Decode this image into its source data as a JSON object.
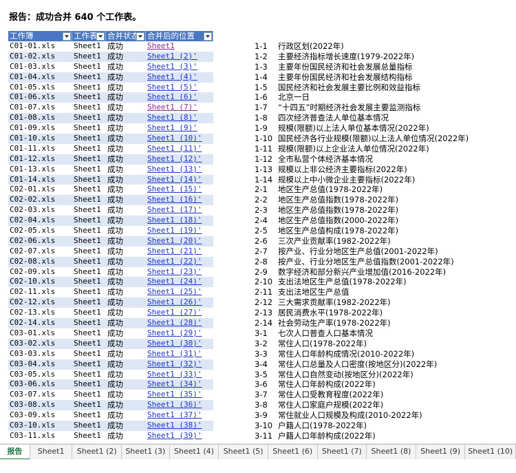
{
  "report_title": "报告：成功合并 640 个工作表。",
  "headers": [
    "工作簿",
    "工作表",
    "合并状态",
    "合并后的位置"
  ],
  "rows": [
    [
      "C01-01.xls",
      "Sheet1",
      "成功",
      "Sheet1"
    ],
    [
      "C01-02.xls",
      "Sheet1",
      "成功",
      "Sheet1 (2)'"
    ],
    [
      "C01-03.xls",
      "Sheet1",
      "成功",
      "Sheet1 (3)'"
    ],
    [
      "C01-04.xls",
      "Sheet1",
      "成功",
      "Sheet1 (4)'"
    ],
    [
      "C01-05.xls",
      "Sheet1",
      "成功",
      "Sheet1 (5)'"
    ],
    [
      "C01-06.xls",
      "Sheet1",
      "成功",
      "Sheet1 (6)'"
    ],
    [
      "C01-07.xls",
      "Sheet1",
      "成功",
      "Sheet1 (7)'"
    ],
    [
      "C01-08.xls",
      "Sheet1",
      "成功",
      "Sheet1 (8)'"
    ],
    [
      "C01-09.xls",
      "Sheet1",
      "成功",
      "Sheet1 (9)'"
    ],
    [
      "C01-10.xls",
      "Sheet1",
      "成功",
      "Sheet1 (10)'"
    ],
    [
      "C01-11.xls",
      "Sheet1",
      "成功",
      "Sheet1 (11)'"
    ],
    [
      "C01-12.xls",
      "Sheet1",
      "成功",
      "Sheet1 (12)'"
    ],
    [
      "C01-13.xls",
      "Sheet1",
      "成功",
      "Sheet1 (13)'"
    ],
    [
      "C01-14.xls",
      "Sheet1",
      "成功",
      "Sheet1 (14)'"
    ],
    [
      "C02-01.xls",
      "Sheet1",
      "成功",
      "Sheet1 (15)'"
    ],
    [
      "C02-02.xls",
      "Sheet1",
      "成功",
      "Sheet1 (16)'"
    ],
    [
      "C02-03.xls",
      "Sheet1",
      "成功",
      "Sheet1 (17)'"
    ],
    [
      "C02-04.xls",
      "Sheet1",
      "成功",
      "Sheet1 (18)'"
    ],
    [
      "C02-05.xls",
      "Sheet1",
      "成功",
      "Sheet1 (19)'"
    ],
    [
      "C02-06.xls",
      "Sheet1",
      "成功",
      "Sheet1 (20)'"
    ],
    [
      "C02-07.xls",
      "Sheet1",
      "成功",
      "Sheet1 (21)'"
    ],
    [
      "C02-08.xls",
      "Sheet1",
      "成功",
      "Sheet1 (22)'"
    ],
    [
      "C02-09.xls",
      "Sheet1",
      "成功",
      "Sheet1 (23)'"
    ],
    [
      "C02-10.xls",
      "Sheet1",
      "成功",
      "Sheet1 (24)'"
    ],
    [
      "C02-11.xls",
      "Sheet1",
      "成功",
      "Sheet1 (25)'"
    ],
    [
      "C02-12.xls",
      "Sheet1",
      "成功",
      "Sheet1 (26)'"
    ],
    [
      "C02-13.xls",
      "Sheet1",
      "成功",
      "Sheet1 (27)'"
    ],
    [
      "C02-14.xls",
      "Sheet1",
      "成功",
      "Sheet1 (28)'"
    ],
    [
      "C03-01.xls",
      "Sheet1",
      "成功",
      "Sheet1 (29)'"
    ],
    [
      "C03-02.xls",
      "Sheet1",
      "成功",
      "Sheet1 (30)'"
    ],
    [
      "C03-03.xls",
      "Sheet1",
      "成功",
      "Sheet1 (31)'"
    ],
    [
      "C03-04.xls",
      "Sheet1",
      "成功",
      "Sheet1 (32)'"
    ],
    [
      "C03-05.xls",
      "Sheet1",
      "成功",
      "Sheet1 (33)'"
    ],
    [
      "C03-06.xls",
      "Sheet1",
      "成功",
      "Sheet1 (34)'"
    ],
    [
      "C03-07.xls",
      "Sheet1",
      "成功",
      "Sheet1 (35)'"
    ],
    [
      "C03-08.xls",
      "Sheet1",
      "成功",
      "Sheet1 (36)'"
    ],
    [
      "C03-09.xls",
      "Sheet1",
      "成功",
      "Sheet1 (37)'"
    ],
    [
      "C03-10.xls",
      "Sheet1",
      "成功",
      "Sheet1 (38)'"
    ],
    [
      "C03-11.xls",
      "Sheet1",
      "成功",
      "Sheet1 (39)'"
    ]
  ],
  "visited_links": [
    0,
    6
  ],
  "index_list": [
    [
      "1-1",
      "行政区划(2022年)"
    ],
    [
      "1-2",
      "主要经济指标增长速度(1979-2022年)"
    ],
    [
      "1-3",
      "主要年份国民经济和社会发展总量指标"
    ],
    [
      "1-4",
      "主要年份国民经济和社会发展结构指标"
    ],
    [
      "1-5",
      "国民经济和社会发展主要比例和效益指标"
    ],
    [
      "1-6",
      "北京一日"
    ],
    [
      "1-7",
      "“十四五”时期经济社会发展主要监测指标"
    ],
    [
      "1-8",
      "四次经济普查法人单位基本情况"
    ],
    [
      "1-9",
      "规模(限额)以上法人单位基本情况(2022年)"
    ],
    [
      "1-10",
      "国民经济各行业规模(限额)以上法人单位情况(2022年)"
    ],
    [
      "1-11",
      "规模(限额)以上企业法人单位情况(2022年)"
    ],
    [
      "1-12",
      "全市私营个体经济基本情况"
    ],
    [
      "1-13",
      "规模以上非公经济主要指标(2022年)"
    ],
    [
      "1-14",
      "规模以上中小微企业主要指标(2022年)"
    ],
    [
      "2-1",
      "地区生产总值(1978-2022年)"
    ],
    [
      "2-2",
      "地区生产总值指数(1978-2022年)"
    ],
    [
      "2-3",
      "地区生产总值指数(1978-2022年)"
    ],
    [
      "2-4",
      "地区生产总值指数(2000-2022年)"
    ],
    [
      "2-5",
      "地区生产总值构成(1978-2022年)"
    ],
    [
      "2-6",
      "三次产业贡献率(1982-2022年)"
    ],
    [
      "2-7",
      "按产业、行业分地区生产总值(2001-2022年)"
    ],
    [
      "2-8",
      "按产业、行业分地区生产总值指数(2001-2022年)"
    ],
    [
      "2-9",
      "数字经济和部分新兴产业增加值(2016-2022年)"
    ],
    [
      "2-10",
      "支出法地区生产总值(1978-2022年)"
    ],
    [
      "2-11",
      "支出法地区生产总值"
    ],
    [
      "2-12",
      "三大需求贡献率(1982-2022年)"
    ],
    [
      "2-13",
      "居民消费水平(1978-2022年)"
    ],
    [
      "2-14",
      "社会劳动生产率(1978-2022年)"
    ],
    [
      "3-1",
      "七次人口普查人口基本情况"
    ],
    [
      "3-2",
      "常住人口(1978-2022年)"
    ],
    [
      "3-3",
      "常住人口年龄构成情况(2010-2022年)"
    ],
    [
      "3-4",
      "常住人口总量及人口密度(按地区分)(2022年)"
    ],
    [
      "3-5",
      "常住人口自然变动(按地区分)(2022年)"
    ],
    [
      "3-6",
      "常住人口年龄构成(2022年)"
    ],
    [
      "3-7",
      "常住人口受教育程度(2022年)"
    ],
    [
      "3-8",
      "常住人口家庭户规模(2022年)"
    ],
    [
      "3-9",
      "常住就业人口规模及构成(2010-2022年)"
    ],
    [
      "3-10",
      "户籍人口(1978-2022年)"
    ],
    [
      "3-11",
      "户籍人口年龄构成(2022年)"
    ]
  ],
  "sheet_tabs": [
    "报告",
    "Sheet1",
    "Sheet1 (2)",
    "Sheet1 (3)",
    "Sheet1 (4)",
    "Sheet1 (5)",
    "Sheet1 (6)",
    "Sheet1 (7)",
    "Sheet1 (8)",
    "Sheet1 (9)",
    "Sheet1 (10)"
  ],
  "active_tab": 0,
  "colors": {
    "header_bg": "#4a77c3",
    "band_bg": "#dce6f4",
    "link": "#1f35c6",
    "visited_link": "#8a2b8a",
    "active_tab": "#217346"
  }
}
